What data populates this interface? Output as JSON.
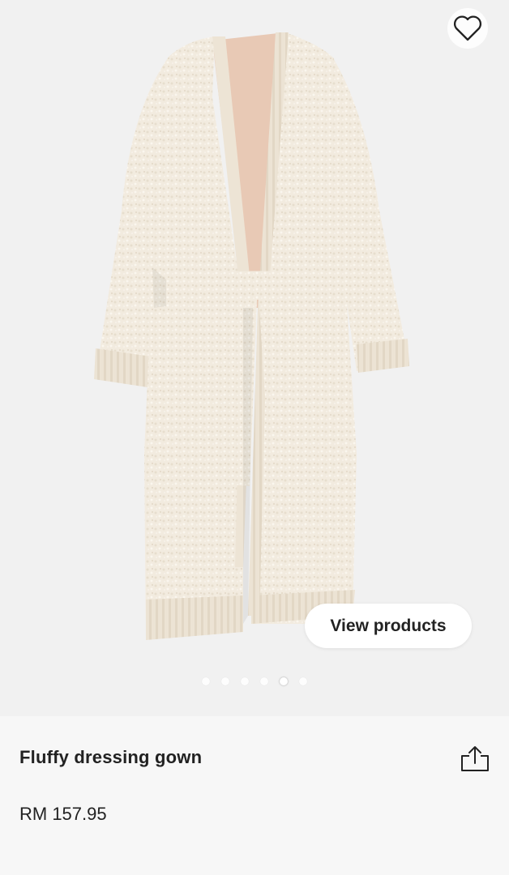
{
  "product": {
    "title": "Fluffy dressing gown",
    "price": "RM 157.95",
    "image_alt": "cream fluffy knit dressing gown with tie belt"
  },
  "gallery": {
    "view_products_label": "View products",
    "total_images": 6,
    "active_index": 4
  },
  "icons": {
    "wishlist": "heart-outline-icon",
    "share": "share-icon"
  },
  "colors": {
    "background": "#f1f1f1",
    "info_background": "#f7f7f7",
    "text": "#222222",
    "button": "#ffffff",
    "garment": "#f2ebdf"
  }
}
